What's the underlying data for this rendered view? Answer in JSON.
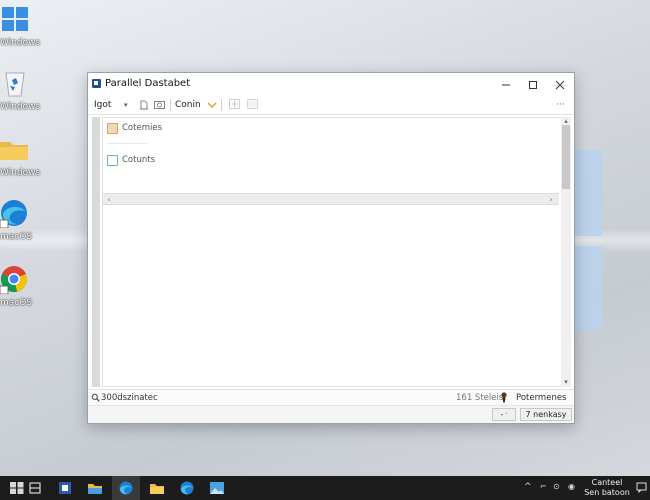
{
  "desktop": {
    "icons": [
      {
        "label": "Windows",
        "icon": "windows-logo-icon"
      },
      {
        "label": "Windows",
        "icon": "recycle-bin-icon"
      },
      {
        "label": "Windows",
        "icon": "folder-icon"
      },
      {
        "label": "macOS",
        "icon": "edge-browser-icon"
      },
      {
        "label": "macOS",
        "icon": "chrome-browser-icon"
      }
    ]
  },
  "window": {
    "title": "Parallel Dastabet",
    "toolbar": {
      "igot_label": "Igot",
      "conin_label": "Conin",
      "more": "···"
    },
    "items": [
      {
        "label": "Cotemies"
      },
      {
        "label": "Cotunts"
      }
    ],
    "status": {
      "left": "300dszinatec",
      "mid": "161 Steleis",
      "right": "Potermenes"
    },
    "buttons": {
      "small": "-",
      "main": "7 nenkasy"
    }
  },
  "taskbar": {
    "clock_line1": "Canteel",
    "clock_line2": "Sen batoon"
  },
  "colors": {
    "accent": "#1f4f9c",
    "taskbar": "#1c1c1c",
    "item1_box": "#f3d6b8",
    "item2_box": "#7cbf7c"
  }
}
